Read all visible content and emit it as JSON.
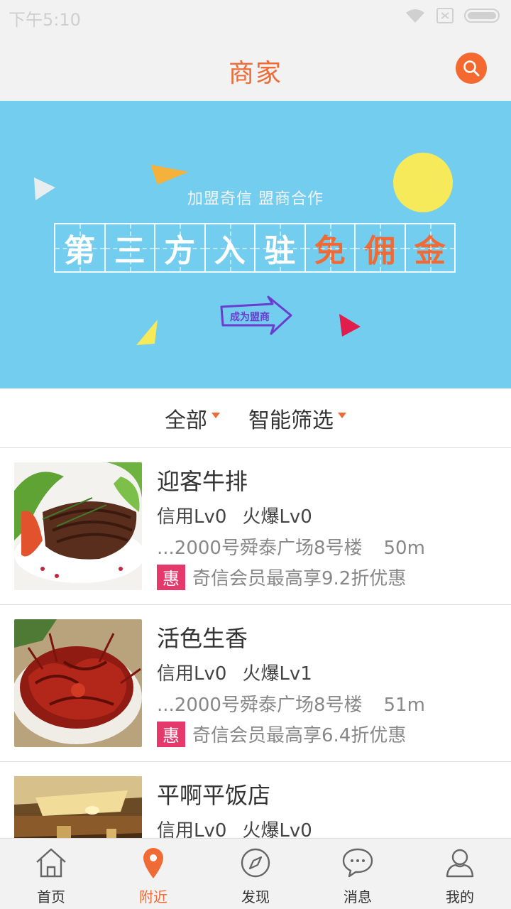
{
  "status": {
    "time": "下午5:10"
  },
  "header": {
    "title": "商家"
  },
  "banner": {
    "subtitle": "加盟奇信 盟商合作",
    "chars": [
      "第",
      "三",
      "方",
      "入",
      "驻",
      "免",
      "佣",
      "金"
    ],
    "cta": "成为盟商"
  },
  "filters": [
    {
      "label": "全部"
    },
    {
      "label": "智能筛选"
    }
  ],
  "merchants": [
    {
      "name": "迎客牛排",
      "credit": "信用Lv0",
      "hot": "火爆Lv0",
      "address": "...2000号舜泰广场8号楼",
      "distance": "50m",
      "promo_tag": "惠",
      "promo_text": "奇信会员最高享9.2折优惠"
    },
    {
      "name": "活色生香",
      "credit": "信用Lv0",
      "hot": "火爆Lv1",
      "address": "...2000号舜泰广场8号楼",
      "distance": "51m",
      "promo_tag": "惠",
      "promo_text": "奇信会员最高享6.4折优惠"
    },
    {
      "name": "平啊平饭店",
      "credit": "信用Lv0",
      "hot": "火爆Lv0"
    }
  ],
  "tabs": [
    {
      "label": "首页",
      "icon": "home-icon"
    },
    {
      "label": "附近",
      "icon": "location-pin-icon"
    },
    {
      "label": "发现",
      "icon": "compass-icon"
    },
    {
      "label": "消息",
      "icon": "chat-bubble-icon"
    },
    {
      "label": "我的",
      "icon": "user-icon"
    }
  ],
  "colors": {
    "accent": "#f06a35",
    "banner_bg": "#72cdef",
    "promo_tag": "#e5386b"
  }
}
